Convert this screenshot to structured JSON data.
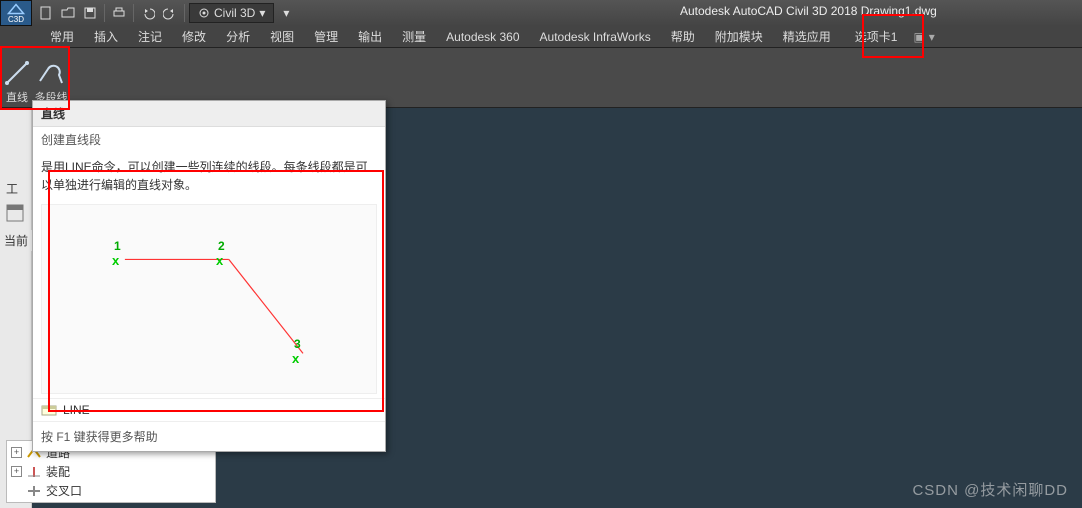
{
  "title": "Autodesk AutoCAD Civil 3D 2018     Drawing1.dwg",
  "workspace": {
    "label": "Civil 3D",
    "app_small": "C3D"
  },
  "tabs": [
    "常用",
    "插入",
    "注记",
    "修改",
    "分析",
    "视图",
    "管理",
    "输出",
    "测量",
    "Autodesk 360",
    "Autodesk InfraWorks",
    "帮助",
    "附加模块",
    "精选应用",
    "选项卡1"
  ],
  "tools": {
    "line": "直线",
    "pline": "多段线"
  },
  "panel_title": "当前",
  "tooltip": {
    "title": "直线",
    "subtitle": "创建直线段",
    "body": "是用LINE命令，可以创建一些列连续的线段。每条线段都是可以单独进行编辑的直线对象。",
    "cmd": "LINE",
    "help": "按 F1 键获得更多帮助",
    "points": {
      "p1": "1",
      "p2": "2",
      "p3": "3"
    }
  },
  "tree": {
    "root_expander": "-",
    "items": [
      {
        "exp": "+",
        "label": "道路"
      },
      {
        "exp": "+",
        "label": "装配"
      },
      {
        "exp": "",
        "label": "交叉口"
      }
    ]
  },
  "left_tool_label": "工",
  "watermark": "CSDN @技术闲聊DD"
}
